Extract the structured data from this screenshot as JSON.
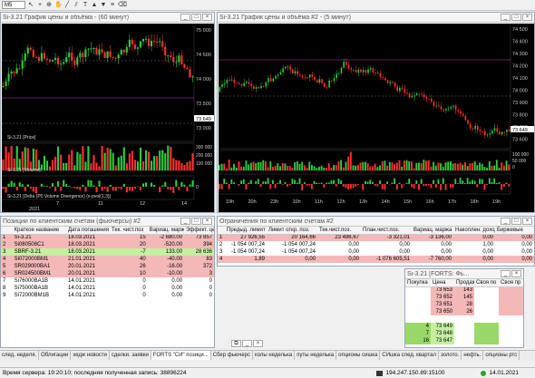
{
  "toolbar": {
    "period_select": "M5"
  },
  "win1": {
    "title": "Si-3.21 График цены и объёма - (60 минут)",
    "price_axis": [
      "75 000",
      "74 500",
      "74 000",
      "73 500",
      "73 000"
    ],
    "last_price_tag": "73 649",
    "price_label": "Si-3.21 [Price]",
    "volume_label": "Si-3.21 [Volume]",
    "volume_axis": [
      "300 000",
      "200 000",
      "100 000"
    ],
    "delta_label": "Si-3.21 [Delta (P0 Volume Divergence) (x-pvol(1,3)]",
    "delta_axis": [
      "0"
    ],
    "date_ticks": [
      "7",
      "11",
      "12",
      "14"
    ],
    "year_label": "2021"
  },
  "win2": {
    "title": "Si-3.21 График цены и объёма #2 - (5 минут)",
    "price_axis": [
      "74 500",
      "74 400",
      "74 300",
      "74 200",
      "74 100",
      "74 000",
      "73 900",
      "73 800",
      "73 700",
      "73 600"
    ],
    "last_price_tag": "73 649",
    "volume_axis": [
      "100 000",
      "50 000",
      "0"
    ],
    "time_ticks": [
      "19h",
      "20h",
      "23h",
      "10h",
      "11h",
      "12h",
      "13h",
      "14h",
      "15h",
      "16h",
      "17h",
      "18h",
      "19h"
    ]
  },
  "positions": {
    "title": "Позиции по клиентским счетам (фьючерсы) #2",
    "columns": [
      "Краткое название",
      "Дата погашения",
      "Тек. чист.поз",
      "Вариац. маржа",
      "Эффект. цен"
    ],
    "rows": [
      {
        "name": "Si-3.21",
        "date": "18.03.2021",
        "net": "15",
        "vm": "-2 680.00",
        "price": "73 857",
        "color": "#f4b8b8"
      },
      {
        "name": "Si080508C1",
        "date": "18.03.2021",
        "net": "20",
        "vm": "-520.00",
        "price": "394",
        "color": "#f4b8b8"
      },
      {
        "name": "SBRF-3.21",
        "date": "18.03.2021",
        "net": "-7",
        "vm": "133.00",
        "price": "28 636",
        "color": "#c4f0a0"
      },
      {
        "name": "Si072000BM1",
        "date": "21.01.2021",
        "net": "40",
        "vm": "-40.00",
        "price": "83",
        "color": "#f4b8b8"
      },
      {
        "name": "SR029000BA1",
        "date": "20.01.2021",
        "net": "26",
        "vm": "-16.00",
        "price": "372",
        "color": "#f4b8b8"
      },
      {
        "name": "SR024500BM1",
        "date": "20.01.2021",
        "net": "10",
        "vm": "-10.00",
        "price": "3",
        "color": "#f4b8b8"
      },
      {
        "name": "Si76000BA1B",
        "date": "14.01.2021",
        "net": "0",
        "vm": "0.00",
        "price": "0",
        "color": "#ffffff"
      },
      {
        "name": "Si75000BA1B",
        "date": "14.01.2021",
        "net": "0",
        "vm": "0.00",
        "price": "0",
        "color": "#ffffff"
      },
      {
        "name": "Si72000BM1B",
        "date": "14.01.2021",
        "net": "0",
        "vm": "0.00",
        "price": "0",
        "color": "#ffffff"
      }
    ]
  },
  "limits": {
    "title": "Ограничения по клиентским счетам #2",
    "columns": [
      "Предыд. лимит",
      "Лимит откр. поз.",
      "Тек.чист.поз.",
      "План.чист.поз.",
      "Вариац. маржа",
      "Накоплен. доход",
      "Биржевые"
    ],
    "rows": [
      {
        "n": "1",
        "c": [
          "27 926,55",
          "20 164,66",
          "23 486,67",
          "-3 321,01",
          "-3 136,00",
          "0,00",
          "0,00"
        ],
        "color": "#f4b8b8"
      },
      {
        "n": "2",
        "c": [
          "-1 054 007,24",
          "-1 054 007,24",
          "0,00",
          "0,00",
          "0,00",
          "1,00",
          "0,00"
        ],
        "color": "#ffffff"
      },
      {
        "n": "3",
        "c": [
          "-1 054 007,24",
          "-1 054 007,24",
          "0,00",
          "0,00",
          "0,00",
          "0,00",
          "0,00"
        ],
        "color": "#ffffff"
      },
      {
        "n": "4",
        "c": [
          "1,89",
          "0,00",
          "0,00",
          "-1 076 605,51",
          "-7 760,00",
          "0,00",
          "0,00"
        ],
        "color": "#f4b8b8"
      }
    ]
  },
  "orderbook": {
    "title": "Si-3.21 [FORTS: Фь...",
    "columns": [
      "Покупка",
      "Цена",
      "Продажа",
      "Своя по",
      "Своя пр"
    ],
    "asks": [
      {
        "price": "73 653",
        "qty": "143"
      },
      {
        "price": "73 652",
        "qty": "145"
      },
      {
        "price": "73 651",
        "qty": "28"
      },
      {
        "price": "73 650",
        "qty": "26"
      }
    ],
    "bids": [
      {
        "qty": "4",
        "price": "73 649"
      },
      {
        "qty": "7",
        "price": "73 648"
      },
      {
        "qty": "16",
        "price": "73 647"
      }
    ]
  },
  "tabs": [
    "след. неделя.",
    "Облигации",
    "хедж новости",
    "сделки. заявки",
    "FORTS \"СИ\" позици...",
    "Сбер фьючерс",
    "колы неделька",
    "путы неделька",
    "опционы сишка",
    "СИшка след. квартал",
    "золото.",
    "нефть.",
    "опционы ртс"
  ],
  "status": {
    "server_time_label": "Время сервера: 19:20:10; последняя полученная запись: 38896224",
    "ip": "194.247.150.89:15100",
    "date": "14.01.2021"
  }
}
